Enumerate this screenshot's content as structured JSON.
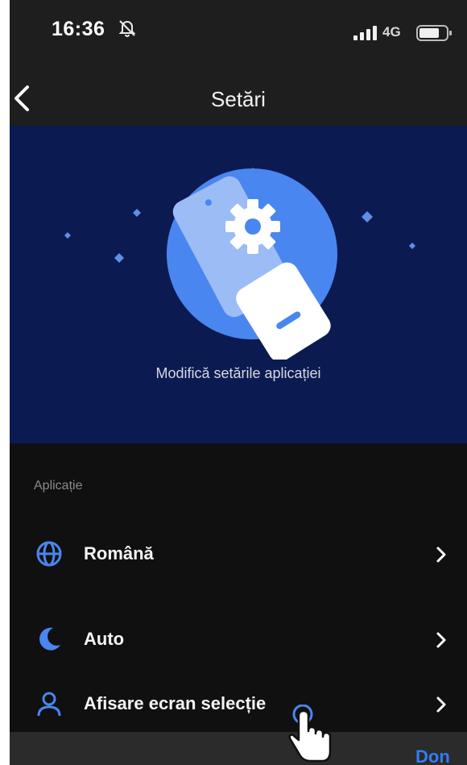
{
  "status_bar": {
    "time": "16:36",
    "network": "4G",
    "icons": [
      "bell-slash-icon",
      "signal-bars-icon",
      "battery-icon"
    ]
  },
  "nav": {
    "back_icon": "chevron-left-icon",
    "title": "Setări"
  },
  "hero": {
    "illustration": "phone-gear-icon",
    "subtitle": "Modifică setările aplicației"
  },
  "section": {
    "label": "Aplicație"
  },
  "items": [
    {
      "label": "Română",
      "icon": "globe-icon"
    },
    {
      "label": "Auto",
      "icon": "moon-icon"
    },
    {
      "label": "Afisare ecran selecție",
      "icon": "person-icon"
    }
  ],
  "bottom_bar": {
    "done_label": "Don"
  },
  "colors": {
    "accent": "#4a86f0",
    "hero_bg": "#0b1b52",
    "background": "#101010",
    "bar_bg": "#1e1e1e"
  }
}
